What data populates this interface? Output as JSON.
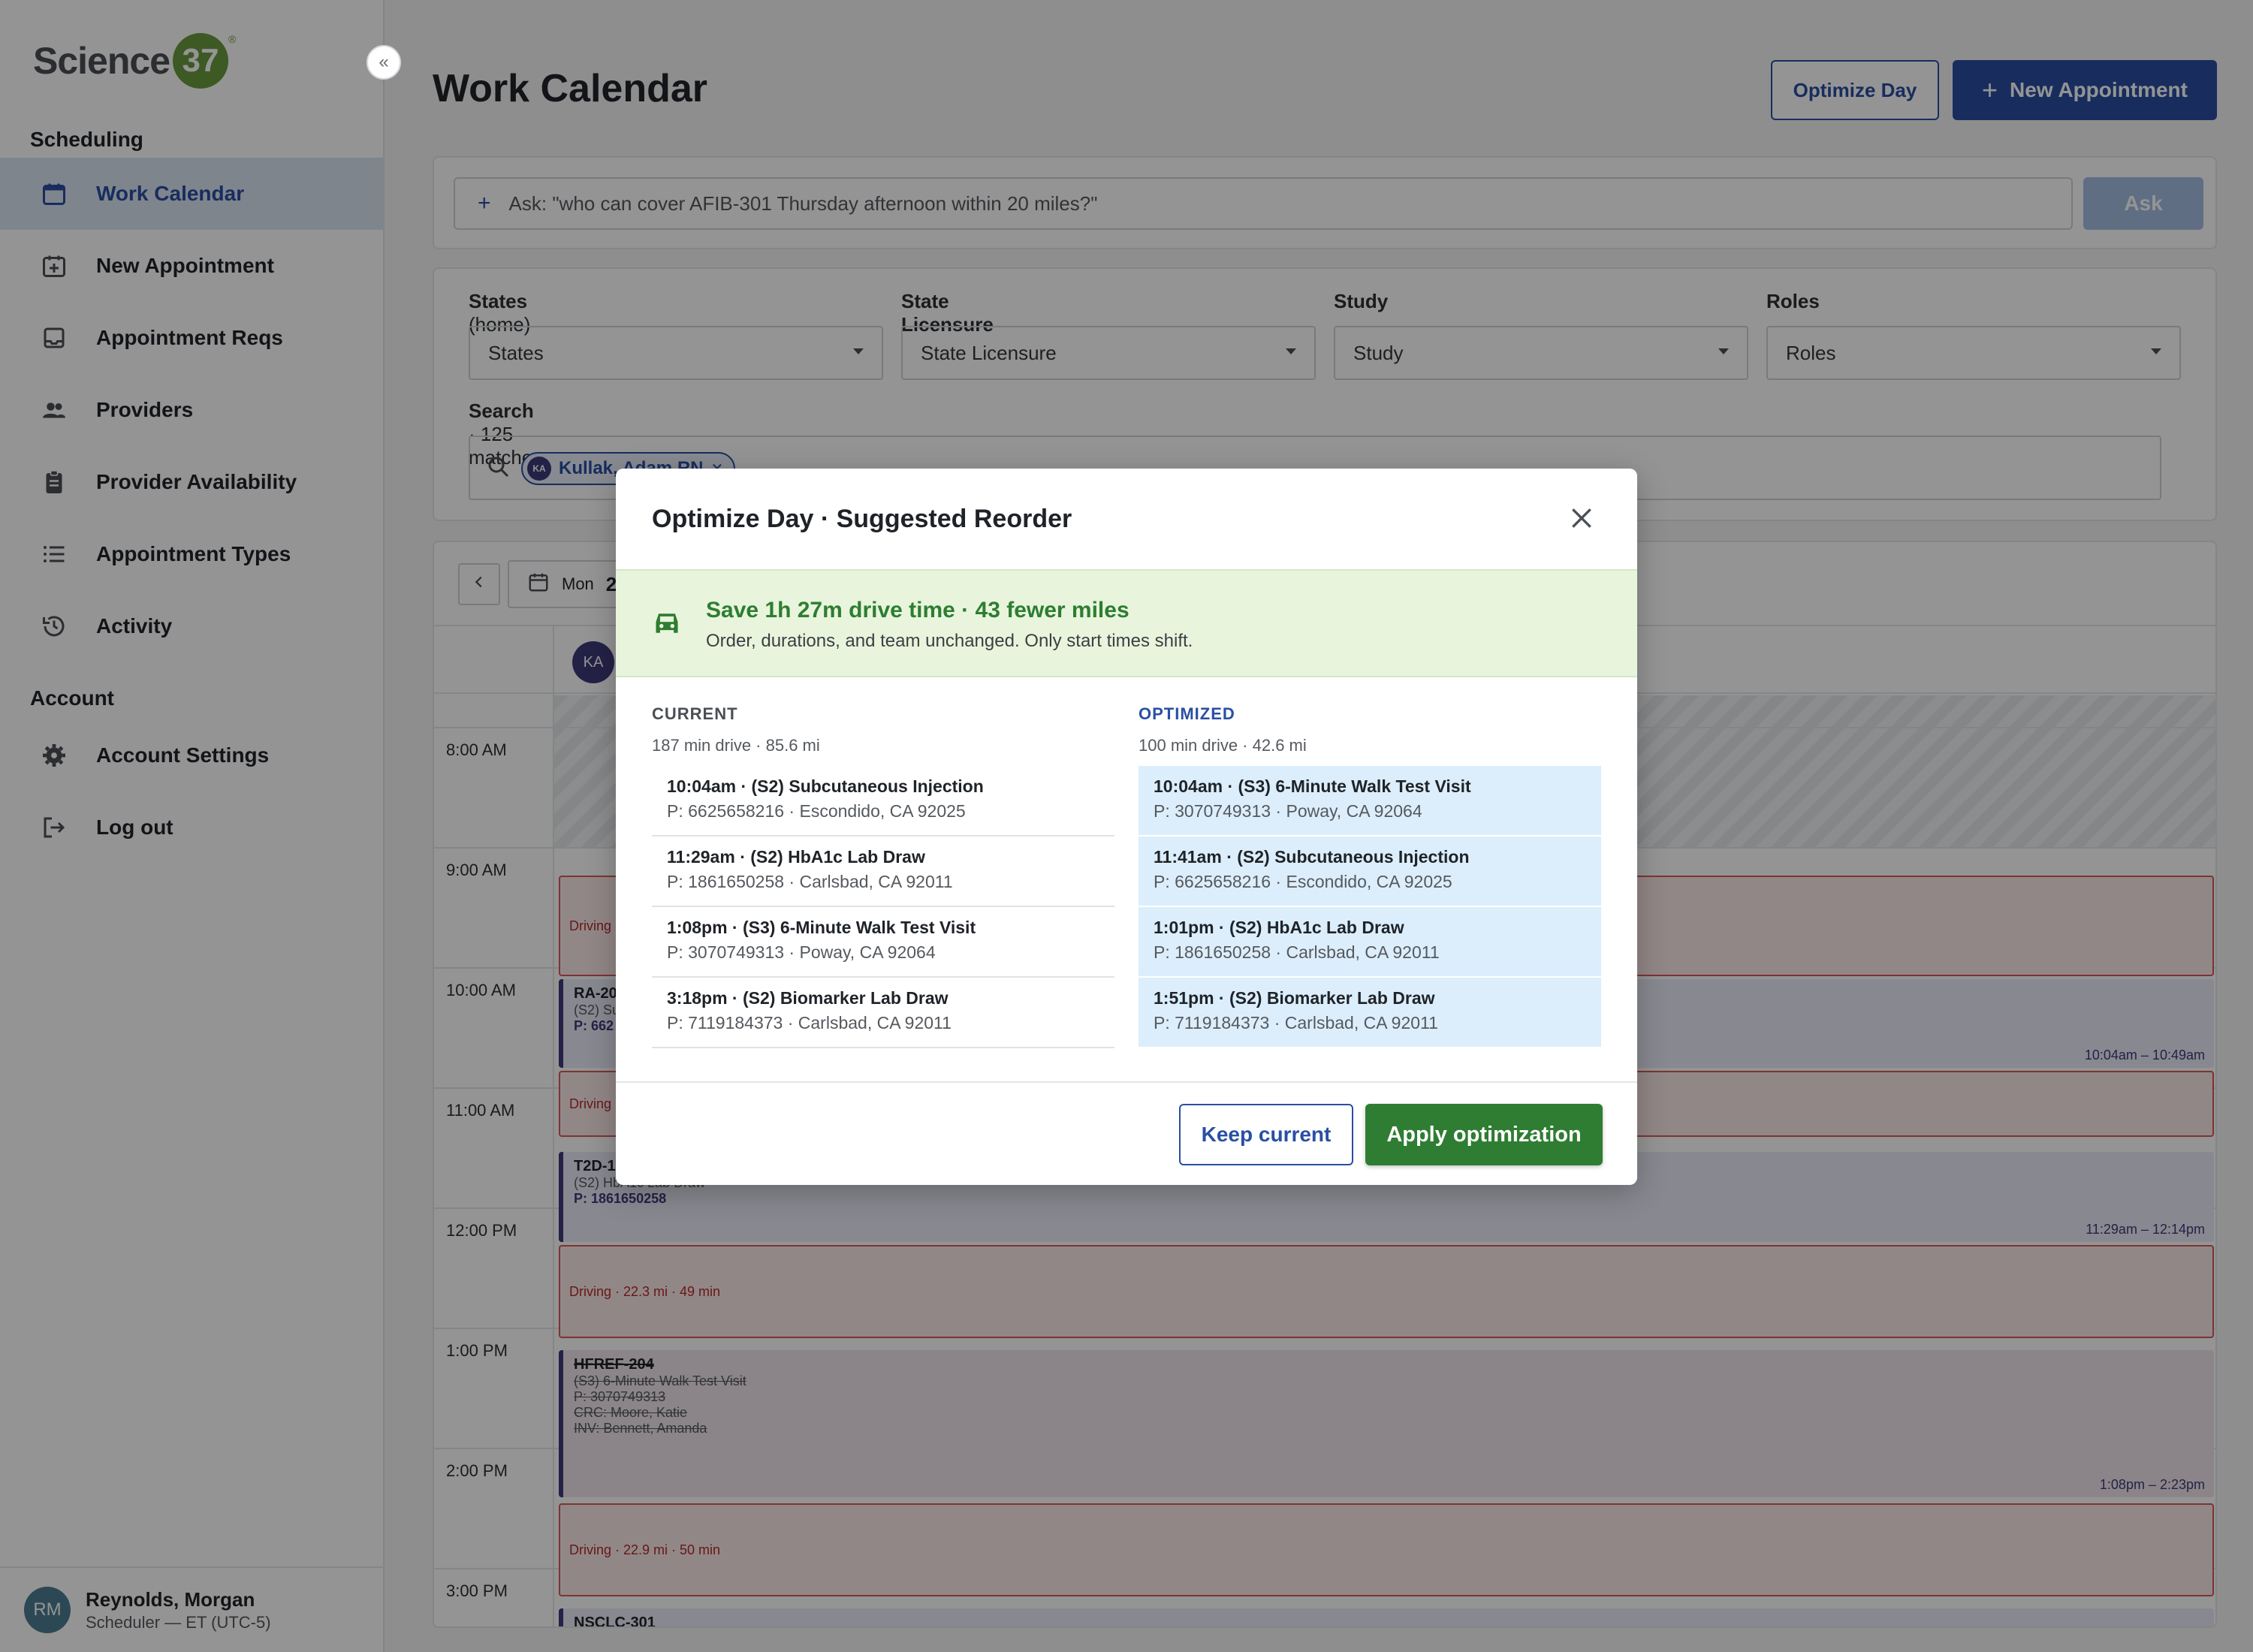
{
  "brand": {
    "name": "Science",
    "number": "37",
    "reg": "®",
    "accent": "#6a9a3e"
  },
  "sidebar": {
    "collapse_label": "«",
    "sections": [
      {
        "title": "Scheduling"
      },
      {
        "title": "Account"
      }
    ],
    "items": [
      {
        "label": "Work Calendar",
        "icon": "calendar-icon",
        "active": true
      },
      {
        "label": "New Appointment",
        "icon": "calendar-plus-icon"
      },
      {
        "label": "Appointment Reqs",
        "icon": "inbox-icon"
      },
      {
        "label": "Providers",
        "icon": "people-icon"
      },
      {
        "label": "Provider Availability",
        "icon": "clipboard-icon"
      },
      {
        "label": "Appointment Types",
        "icon": "list-icon"
      },
      {
        "label": "Activity",
        "icon": "history-icon"
      },
      {
        "label": "Account Settings",
        "icon": "gear-icon"
      },
      {
        "label": "Log out",
        "icon": "logout-icon"
      }
    ],
    "user": {
      "initials": "RM",
      "name": "Reynolds, Morgan",
      "role": "Scheduler — ET (UTC-5)"
    }
  },
  "header": {
    "title": "Work Calendar",
    "optimize_label": "Optimize Day",
    "new_appt_label": "New Appointment"
  },
  "ask": {
    "placeholder": "Ask: \"who can cover AFIB-301 Thursday afternoon within 20 miles?\"",
    "button": "Ask"
  },
  "filters": {
    "states_label": "States",
    "states_suffix": "(home)",
    "states_value": "States",
    "licensure_label": "State Licensure",
    "licensure_value": "State Licensure",
    "study_label": "Study",
    "study_value": "Study",
    "roles_label": "Roles",
    "roles_value": "Roles",
    "search_label": "Search",
    "search_count": "· 125 matches",
    "chip_initials": "KA",
    "chip_label": "Kullak, Adam RN"
  },
  "calendar": {
    "date_prefix": "Mon",
    "date_partial": "2",
    "provider_initials": "KA",
    "hours": [
      "8:00 AM",
      "9:00 AM",
      "10:00 AM",
      "11:00 AM",
      "12:00 PM",
      "1:00 PM",
      "2:00 PM",
      "3:00 PM"
    ],
    "events": {
      "drive1": "Driving",
      "appt1_code": "RA-20",
      "appt1_sub": "(S2) Su",
      "appt1_ph": "P: 662",
      "appt1_range": "10:04am – 10:49am",
      "drive2": "Driving",
      "appt2_code": "T2D-1",
      "appt2_sub": "(S2) HbA1c Lab Draw",
      "appt2_ph": "P: 1861650258",
      "appt2_range": "11:29am – 12:14pm",
      "drive3": "Driving · 22.3 mi · 49 min",
      "appt3_code": "HFREF-204",
      "appt3_sub": "(S3) 6-Minute Walk Test Visit",
      "appt3_ph": "P: 3070749313",
      "appt3_crc": "CRC: Moore, Katie",
      "appt3_inv": "INV: Bennett, Amanda",
      "appt3_range": "1:08pm – 2:23pm",
      "drive4": "Driving · 22.9 mi · 50 min",
      "appt4_code": "NSCLC-301"
    }
  },
  "modal": {
    "title": "Optimize Day · Suggested Reorder",
    "banner_title": "Save 1h 27m drive time · 43 fewer miles",
    "banner_sub": "Order, durations, and team unchanged. Only start times shift.",
    "current": {
      "heading": "CURRENT",
      "summary": "187 min drive · 85.6 mi",
      "rows": [
        {
          "title": "10:04am · (S2) Subcutaneous Injection",
          "sub": "P: 6625658216 · Escondido, CA 92025"
        },
        {
          "title": "11:29am · (S2) HbA1c Lab Draw",
          "sub": "P: 1861650258 · Carlsbad, CA 92011"
        },
        {
          "title": "1:08pm · (S3) 6-Minute Walk Test Visit",
          "sub": "P: 3070749313 · Poway, CA 92064"
        },
        {
          "title": "3:18pm · (S2) Biomarker Lab Draw",
          "sub": "P: 7119184373 · Carlsbad, CA 92011"
        }
      ]
    },
    "optimized": {
      "heading": "OPTIMIZED",
      "summary": "100 min drive · 42.6 mi",
      "rows": [
        {
          "title": "10:04am · (S3) 6-Minute Walk Test Visit",
          "sub": "P: 3070749313 · Poway, CA 92064"
        },
        {
          "title": "11:41am · (S2) Subcutaneous Injection",
          "sub": "P: 6625658216 · Escondido, CA 92025"
        },
        {
          "title": "1:01pm · (S2) HbA1c Lab Draw",
          "sub": "P: 1861650258 · Carlsbad, CA 92011"
        },
        {
          "title": "1:51pm · (S2) Biomarker Lab Draw",
          "sub": "P: 7119184373 · Carlsbad, CA 92011"
        }
      ]
    },
    "keep_label": "Keep current",
    "apply_label": "Apply optimization"
  }
}
